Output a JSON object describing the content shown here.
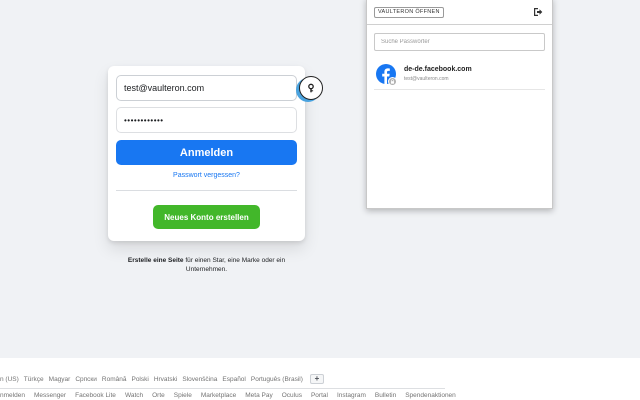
{
  "login": {
    "email_value": "test@vaulteron.com",
    "password_value": "••••••••••••",
    "login_button": "Anmelden",
    "forgot_link": "Passwort vergessen?",
    "create_account_button": "Neues Konto erstellen",
    "create_page_bold": "Erstelle eine Seite",
    "create_page_rest": " für einen Star, eine Marke oder ein Unternehmen."
  },
  "extension": {
    "open_vault_button": "VAULTERON ÖFFNEN",
    "search_placeholder": "Suche Passwörter",
    "entries": [
      {
        "title": "de-de.facebook.com",
        "subtitle": "test@vaulteron.com",
        "icon": "facebook-icon"
      }
    ],
    "badge_icon": "vaulteron-key-icon",
    "logout_icon": "logout-icon"
  },
  "footer": {
    "languages": [
      "n (US)",
      "Türkçe",
      "Magyar",
      "Српски",
      "Română",
      "Polski",
      "Hrvatski",
      "Slovenščina",
      "Español",
      "Português (Brasil)"
    ],
    "add_language": "+",
    "links": [
      "nmelden",
      "Messenger",
      "Facebook Lite",
      "Watch",
      "Orte",
      "Spiele",
      "Marketplace",
      "Meta Pay",
      "Oculus",
      "Portal",
      "Instagram",
      "Bulletin",
      "Spendenaktionen"
    ]
  },
  "colors": {
    "primary": "#1877f2",
    "create": "#42b72a",
    "page_bg": "#f0f2f5"
  }
}
